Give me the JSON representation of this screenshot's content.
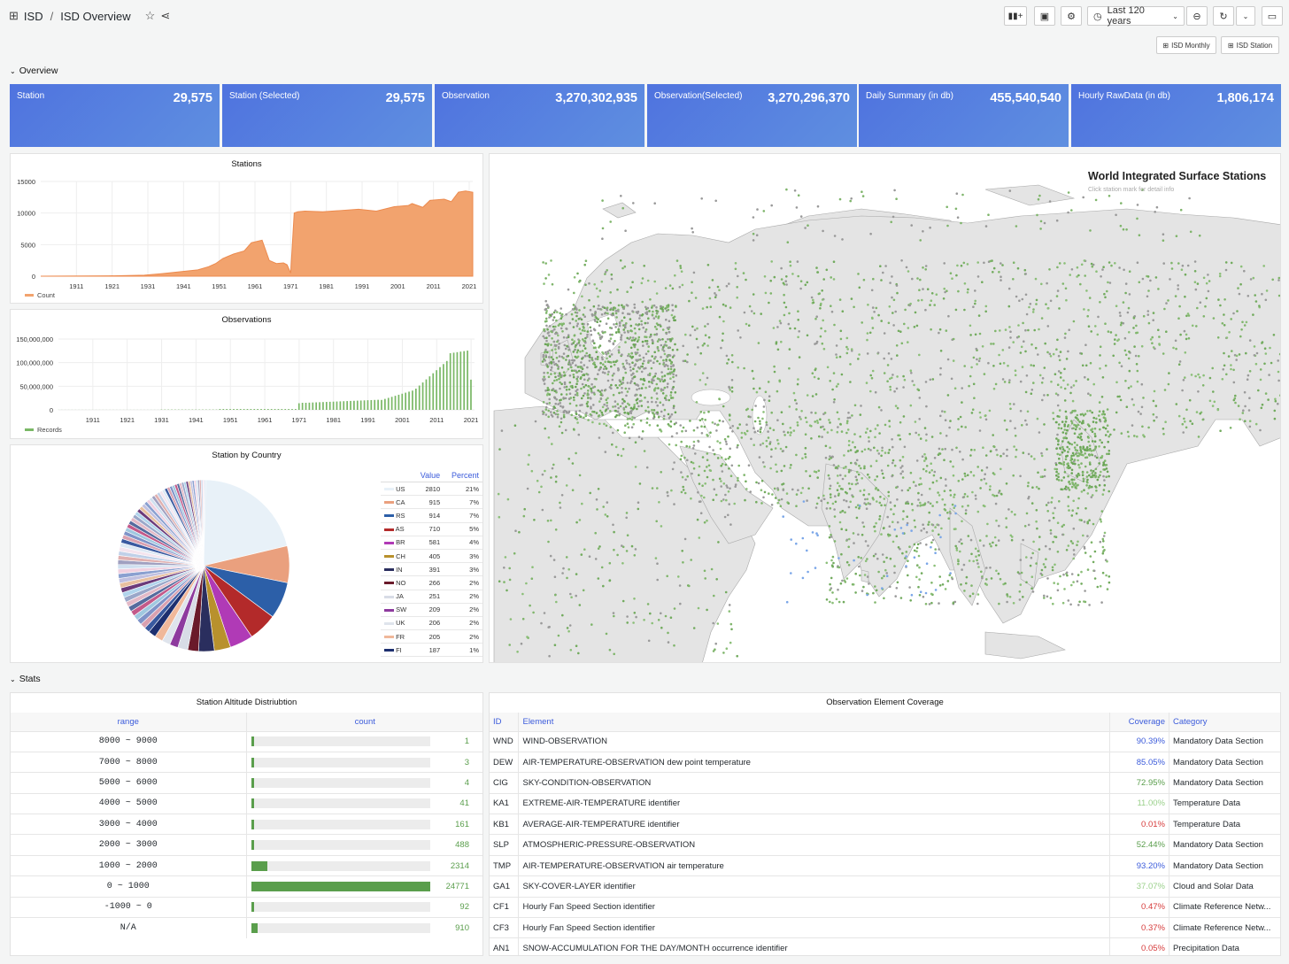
{
  "header": {
    "breadcrumb_root": "ISD",
    "breadcrumb_sep": "/",
    "title": "ISD Overview",
    "time_range": "Last 120 years",
    "links": [
      "ISD Monthly",
      "ISD Station"
    ]
  },
  "rows": {
    "overview": "Overview",
    "stats": "Stats"
  },
  "stats": [
    {
      "label": "Station",
      "value": "29,575"
    },
    {
      "label": "Station (Selected)",
      "value": "29,575"
    },
    {
      "label": "Observation",
      "value": "3,270,302,935"
    },
    {
      "label": "Observation(Selected)",
      "value": "3,270,296,370"
    },
    {
      "label": "Daily Summary (in db)",
      "value": "455,540,540"
    },
    {
      "label": "Hourly RawData (in db)",
      "value": "1,806,174"
    }
  ],
  "chart_data": [
    {
      "type": "area",
      "title": "Stations",
      "series_name": "Count",
      "color": "#f2a36e",
      "ylim": [
        0,
        15000
      ],
      "yticks": [
        "0",
        "5000",
        "10000",
        "15000"
      ],
      "xticks": [
        "1911",
        "1921",
        "1931",
        "1941",
        "1951",
        "1961",
        "1971",
        "1981",
        "1991",
        "2001",
        "2011",
        "2021"
      ],
      "x": [
        1901,
        1920,
        1930,
        1935,
        1940,
        1945,
        1948,
        1950,
        1952,
        1955,
        1958,
        1960,
        1963,
        1965,
        1967,
        1969,
        1970,
        1971,
        1972,
        1973,
        1975,
        1980,
        1985,
        1990,
        1995,
        2000,
        2004,
        2005,
        2008,
        2010,
        2014,
        2016,
        2018,
        2020,
        2022
      ],
      "y": [
        0,
        50,
        150,
        400,
        700,
        1000,
        1500,
        2000,
        2800,
        3500,
        4000,
        5300,
        5700,
        2500,
        2000,
        2100,
        1800,
        500,
        10000,
        10200,
        10300,
        10200,
        10400,
        10600,
        10300,
        11000,
        11200,
        11500,
        10900,
        12000,
        12200,
        11800,
        13300,
        13500,
        13300
      ]
    },
    {
      "type": "bar",
      "title": "Observations",
      "series_name": "Records",
      "color": "#7ab866",
      "ylim": [
        0,
        150000000
      ],
      "yticks": [
        "0",
        "50,000,000",
        "100,000,000",
        "150,000,000"
      ],
      "xticks": [
        "1911",
        "1921",
        "1931",
        "1941",
        "1951",
        "1961",
        "1971",
        "1981",
        "1991",
        "2001",
        "2011",
        "2021"
      ]
    },
    {
      "type": "pie",
      "title": "Station by Country",
      "columns": [
        "Value",
        "Percent"
      ],
      "rows": [
        {
          "name": "US",
          "value": 2810,
          "percent": "21%",
          "color": "#e8f1f8"
        },
        {
          "name": "CA",
          "value": 915,
          "percent": "7%",
          "color": "#eaa07e"
        },
        {
          "name": "RS",
          "value": 914,
          "percent": "7%",
          "color": "#2c5fa8"
        },
        {
          "name": "AS",
          "value": 710,
          "percent": "5%",
          "color": "#b32a2a"
        },
        {
          "name": "BR",
          "value": 581,
          "percent": "4%",
          "color": "#b03ab6"
        },
        {
          "name": "CH",
          "value": 405,
          "percent": "3%",
          "color": "#b8912d"
        },
        {
          "name": "IN",
          "value": 391,
          "percent": "3%",
          "color": "#2a2e5e"
        },
        {
          "name": "NO",
          "value": 266,
          "percent": "2%",
          "color": "#6a1a2a"
        },
        {
          "name": "JA",
          "value": 251,
          "percent": "2%",
          "color": "#d8dce6"
        },
        {
          "name": "SW",
          "value": 209,
          "percent": "2%",
          "color": "#8e3a9e"
        },
        {
          "name": "UK",
          "value": 206,
          "percent": "2%",
          "color": "#dfe4ec"
        },
        {
          "name": "FR",
          "value": 205,
          "percent": "2%",
          "color": "#f0b89a"
        },
        {
          "name": "FI",
          "value": 187,
          "percent": "1%",
          "color": "#1d2f6f"
        }
      ]
    }
  ],
  "map": {
    "title": "World Integrated Surface Stations",
    "subtitle": "Click station mark for detail info"
  },
  "altitude": {
    "title": "Station Altitude Distriubtion",
    "columns": [
      "range",
      "count"
    ],
    "rows": [
      {
        "range": "8000 ~ 9000",
        "count": "1",
        "fill": 0.0004
      },
      {
        "range": "7000 ~ 8000",
        "count": "3",
        "fill": 0.0012
      },
      {
        "range": "5000 ~ 6000",
        "count": "4",
        "fill": 0.0016
      },
      {
        "range": "4000 ~ 5000",
        "count": "41",
        "fill": 0.0017
      },
      {
        "range": "3000 ~ 4000",
        "count": "161",
        "fill": 0.0065
      },
      {
        "range": "2000 ~ 3000",
        "count": "488",
        "fill": 0.0198
      },
      {
        "range": "1000 ~ 2000",
        "count": "2314",
        "fill": 0.0937
      },
      {
        "range": "0 ~ 1000",
        "count": "24771",
        "fill": 1.0
      },
      {
        "range": "-1000 ~ 0",
        "count": "92",
        "fill": 0.0037
      },
      {
        "range": "N/A",
        "count": "910",
        "fill": 0.0367
      }
    ]
  },
  "coverage": {
    "title": "Observation Element Coverage",
    "columns": [
      "ID",
      "Element",
      "Coverage",
      "Category"
    ],
    "rows": [
      {
        "id": "WND",
        "element": "WIND-OBSERVATION",
        "coverage": "90.39%",
        "color": "#3b5bdb",
        "category": "Mandatory Data Section"
      },
      {
        "id": "DEW",
        "element": "AIR-TEMPERATURE-OBSERVATION dew point temperature",
        "coverage": "85.05%",
        "color": "#3b5bdb",
        "category": "Mandatory Data Section"
      },
      {
        "id": "CIG",
        "element": "SKY-CONDITION-OBSERVATION",
        "coverage": "72.95%",
        "color": "#5a9e4c",
        "category": "Mandatory Data Section"
      },
      {
        "id": "KA1",
        "element": "EXTREME-AIR-TEMPERATURE identifier",
        "coverage": "11.00%",
        "color": "#9ad08a",
        "category": "Temperature Data"
      },
      {
        "id": "KB1",
        "element": "AVERAGE-AIR-TEMPERATURE identifier",
        "coverage": "0.01%",
        "color": "#d63b3b",
        "category": "Temperature Data"
      },
      {
        "id": "SLP",
        "element": "ATMOSPHERIC-PRESSURE-OBSERVATION",
        "coverage": "52.44%",
        "color": "#5a9e4c",
        "category": "Mandatory Data Section"
      },
      {
        "id": "TMP",
        "element": "AIR-TEMPERATURE-OBSERVATION air temperature",
        "coverage": "93.20%",
        "color": "#3b5bdb",
        "category": "Mandatory Data Section"
      },
      {
        "id": "GA1",
        "element": "SKY-COVER-LAYER identifier",
        "coverage": "37.07%",
        "color": "#9ad08a",
        "category": "Cloud and Solar Data"
      },
      {
        "id": "CF1",
        "element": "Hourly Fan Speed Section identifier",
        "coverage": "0.47%",
        "color": "#d63b3b",
        "category": "Climate Reference Netw..."
      },
      {
        "id": "CF3",
        "element": "Hourly Fan Speed Section identifier",
        "coverage": "0.37%",
        "color": "#d63b3b",
        "category": "Climate Reference Netw..."
      },
      {
        "id": "AN1",
        "element": "SNOW-ACCUMULATION FOR THE DAY/MONTH occurrence identifier",
        "coverage": "0.05%",
        "color": "#d63b3b",
        "category": "Precipitation Data"
      }
    ]
  }
}
